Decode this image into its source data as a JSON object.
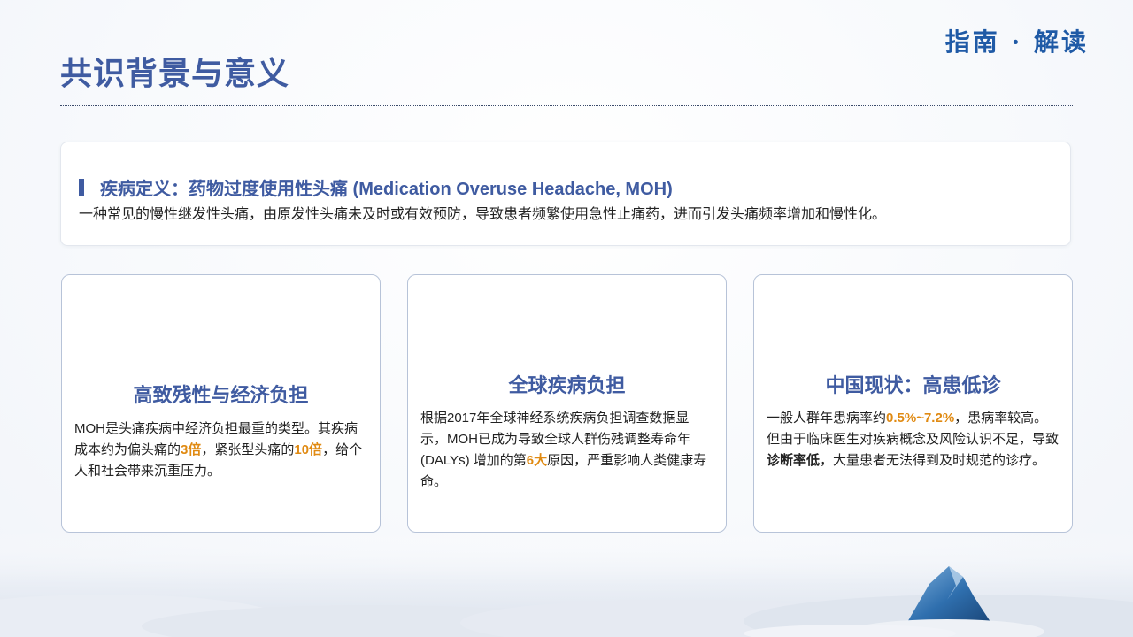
{
  "header": {
    "title": "共识背景与意义",
    "brand": "指南 · 解读"
  },
  "definition": {
    "heading": "疾病定义：药物过度使用性头痛 (Medication Overuse Headache, MOH)",
    "text": "一种常见的慢性继发性头痛，由原发性头痛未及时或有效预防，导致患者频繁使用急性止痛药，进而引发头痛频率增加和慢性化。"
  },
  "cards": [
    {
      "title": "高致残性与经济负担",
      "body_part1": "MOH是头痛疾病中经济负担最重的类型。其疾病成本约为偏头痛的",
      "hl1": "3倍",
      "body_part2": "，紧张型头痛的",
      "hl2": "10倍",
      "body_part3": "，给个人和社会带来沉重压力。"
    },
    {
      "title": "全球疾病负担",
      "body_part1": "根据2017年全球神经系统疾病负担调查数据显示，MOH已成为导致全球人群伤残调整寿命年 (DALYs) 增加的第",
      "hl1": "6大",
      "body_part2": "原因，严重影响人类健康寿命。"
    },
    {
      "title": "中国现状：高患低诊",
      "body_part1": "一般人群年患病率约",
      "hl1": "0.5%~7.2%",
      "body_part2": "，患病率较高。但由于临床医生对疾病概念及风险认识不足，导致",
      "hl2": "诊断率低",
      "body_part3": "，大量患者无法得到及时规范的诊疗。"
    }
  ],
  "colors": {
    "primary": "#3f5ba1",
    "brand": "#1f5aa6",
    "highlight": "#e08a12"
  },
  "decor": {
    "bottom": "cloud-sea-with-mountain-peak-image"
  }
}
